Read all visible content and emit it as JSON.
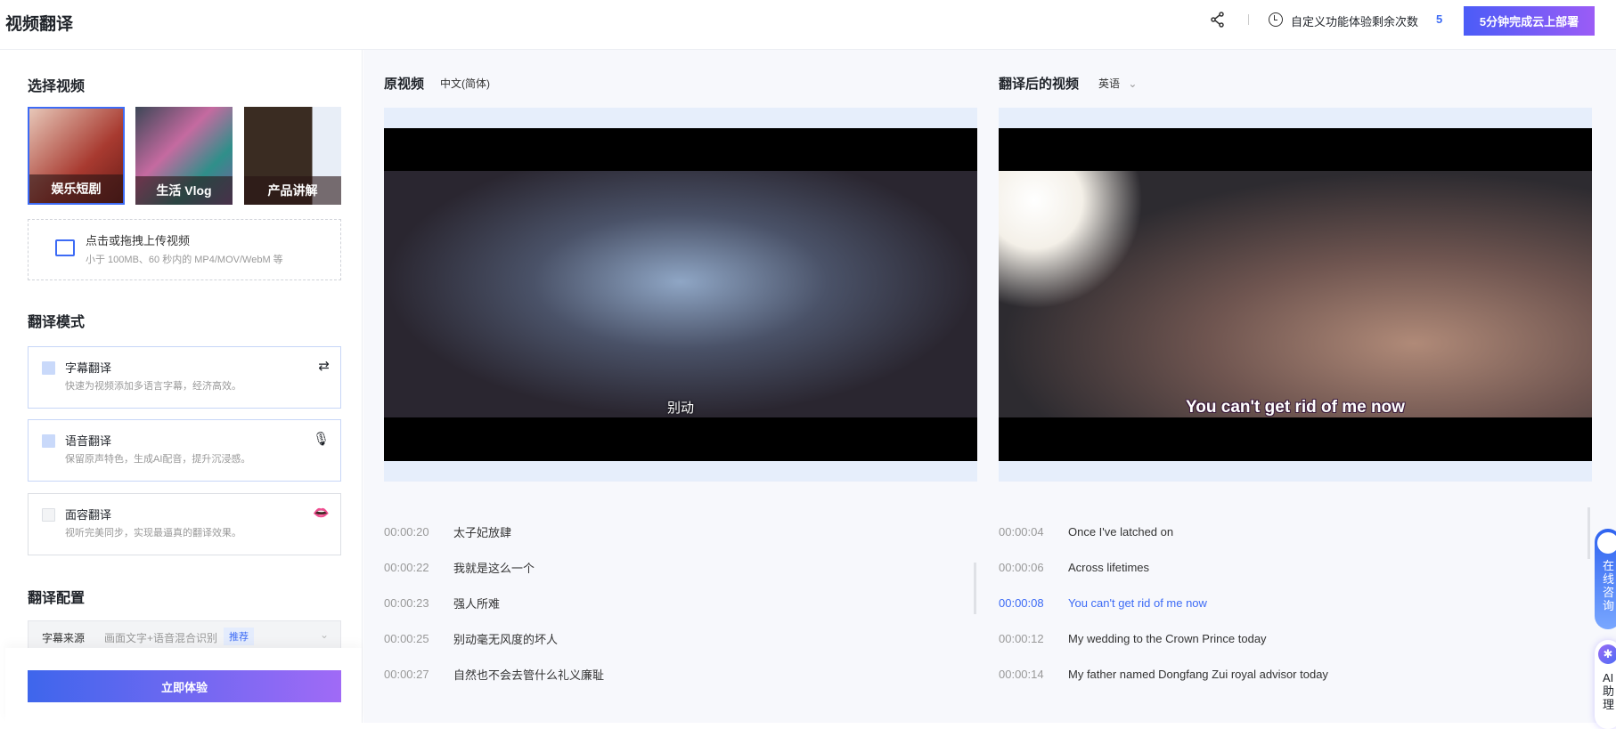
{
  "header": {
    "title": "视频翻译",
    "quota_label": "自定义功能体验剩余次数",
    "quota_count": "5",
    "deploy_button": "5分钟完成云上部署"
  },
  "left": {
    "select_title": "选择视频",
    "thumbnails": [
      {
        "label": "娱乐短剧"
      },
      {
        "label": "生活 Vlog"
      },
      {
        "label": "产品讲解"
      }
    ],
    "upload": {
      "title": "点击或拖拽上传视频",
      "hint": "小于 100MB、60 秒内的 MP4/MOV/WebM 等"
    },
    "mode_title": "翻译模式",
    "modes": [
      {
        "name": "字幕翻译",
        "desc": "快速为视频添加多语言字幕，经济高效。",
        "checked": true,
        "icon": "subtitle-translate-icon"
      },
      {
        "name": "语音翻译",
        "desc": "保留原声特色，生成AI配音，提升沉浸感。",
        "checked": true,
        "icon": "microphone-icon"
      },
      {
        "name": "面容翻译",
        "desc": "视听完美同步，实现最逼真的翻译效果。",
        "checked": false,
        "icon": "lips-icon"
      }
    ],
    "config_title": "翻译配置",
    "config": {
      "label": "字幕来源",
      "value": "画面文字+语音混合识别",
      "badge": "推荐"
    },
    "try_button": "立即体验"
  },
  "original": {
    "title": "原视频",
    "lang": "中文(简体)",
    "subtitle": "别动",
    "rows": [
      {
        "t": "00:00:20",
        "text": "太子妃放肆"
      },
      {
        "t": "00:00:22",
        "text": "我就是这么一个"
      },
      {
        "t": "00:00:23",
        "text": "强人所难"
      },
      {
        "t": "00:00:25",
        "text": "别动毫无风度的坏人"
      },
      {
        "t": "00:00:27",
        "text": "自然也不会去管什么礼义廉耻"
      }
    ]
  },
  "translated": {
    "title": "翻译后的视频",
    "lang": "英语",
    "subtitle": "You can't get rid of me now",
    "rows": [
      {
        "t": "00:00:04",
        "text": "Once I've latched on"
      },
      {
        "t": "00:00:06",
        "text": "Across lifetimes"
      },
      {
        "t": "00:00:08",
        "text": "You can't get rid of me now",
        "active": true
      },
      {
        "t": "00:00:12",
        "text": "My wedding to the Crown Prince today"
      },
      {
        "t": "00:00:14",
        "text": "My father named Dongfang Zui royal advisor today"
      }
    ]
  },
  "widgets": {
    "chat": "在线咨询",
    "ai": "AI助理"
  }
}
